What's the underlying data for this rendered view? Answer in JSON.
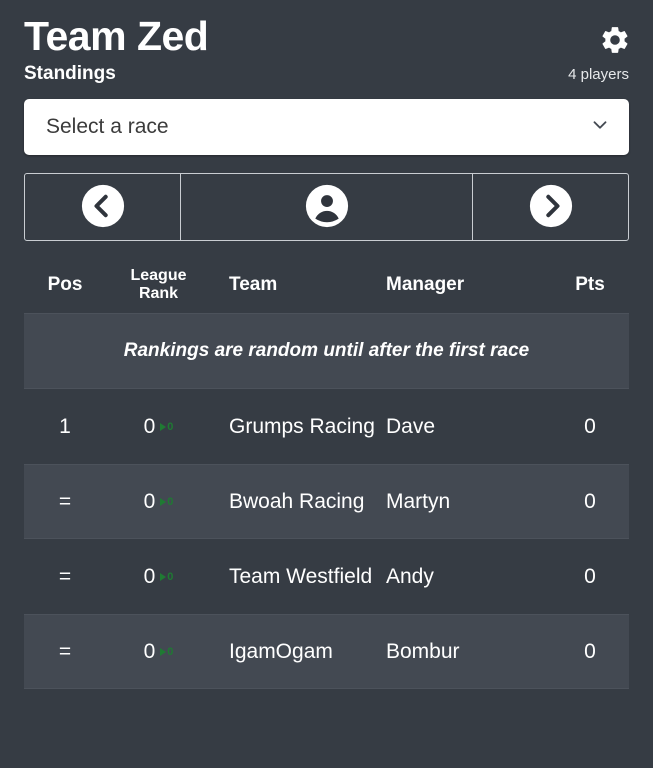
{
  "header": {
    "title": "Team Zed",
    "settings_icon": "gear-icon"
  },
  "subheader": {
    "title": "Standings",
    "player_count": "4 players"
  },
  "race_select": {
    "value": "Select a race",
    "placeholder": "Select a race",
    "chevron_icon": "chevron-down-icon"
  },
  "nav": {
    "prev_icon": "chevron-left-icon",
    "account_icon": "person-icon",
    "next_icon": "chevron-right-icon"
  },
  "table": {
    "columns": {
      "pos": "Pos",
      "rank_line1": "League",
      "rank_line2": "Rank",
      "team": "Team",
      "manager": "Manager",
      "pts": "Pts"
    },
    "notice": "Rankings are random until after the first race",
    "rows": [
      {
        "pos": "1",
        "rank": "0",
        "delta": "0",
        "team": "Grumps Racing",
        "manager": "Dave",
        "pts": "0"
      },
      {
        "pos": "=",
        "rank": "0",
        "delta": "0",
        "team": "Bwoah Racing",
        "manager": "Martyn",
        "pts": "0"
      },
      {
        "pos": "=",
        "rank": "0",
        "delta": "0",
        "team": "Team Westfield",
        "manager": "Andy",
        "pts": "0"
      },
      {
        "pos": "=",
        "rank": "0",
        "delta": "0",
        "team": "IgamOgam",
        "manager": "Bombur",
        "pts": "0"
      }
    ]
  },
  "colors": {
    "background": "#363c44",
    "row_striped": "#434952",
    "text": "#ffffff",
    "delta_green": "#1f7a33",
    "select_background": "#ffffff"
  }
}
